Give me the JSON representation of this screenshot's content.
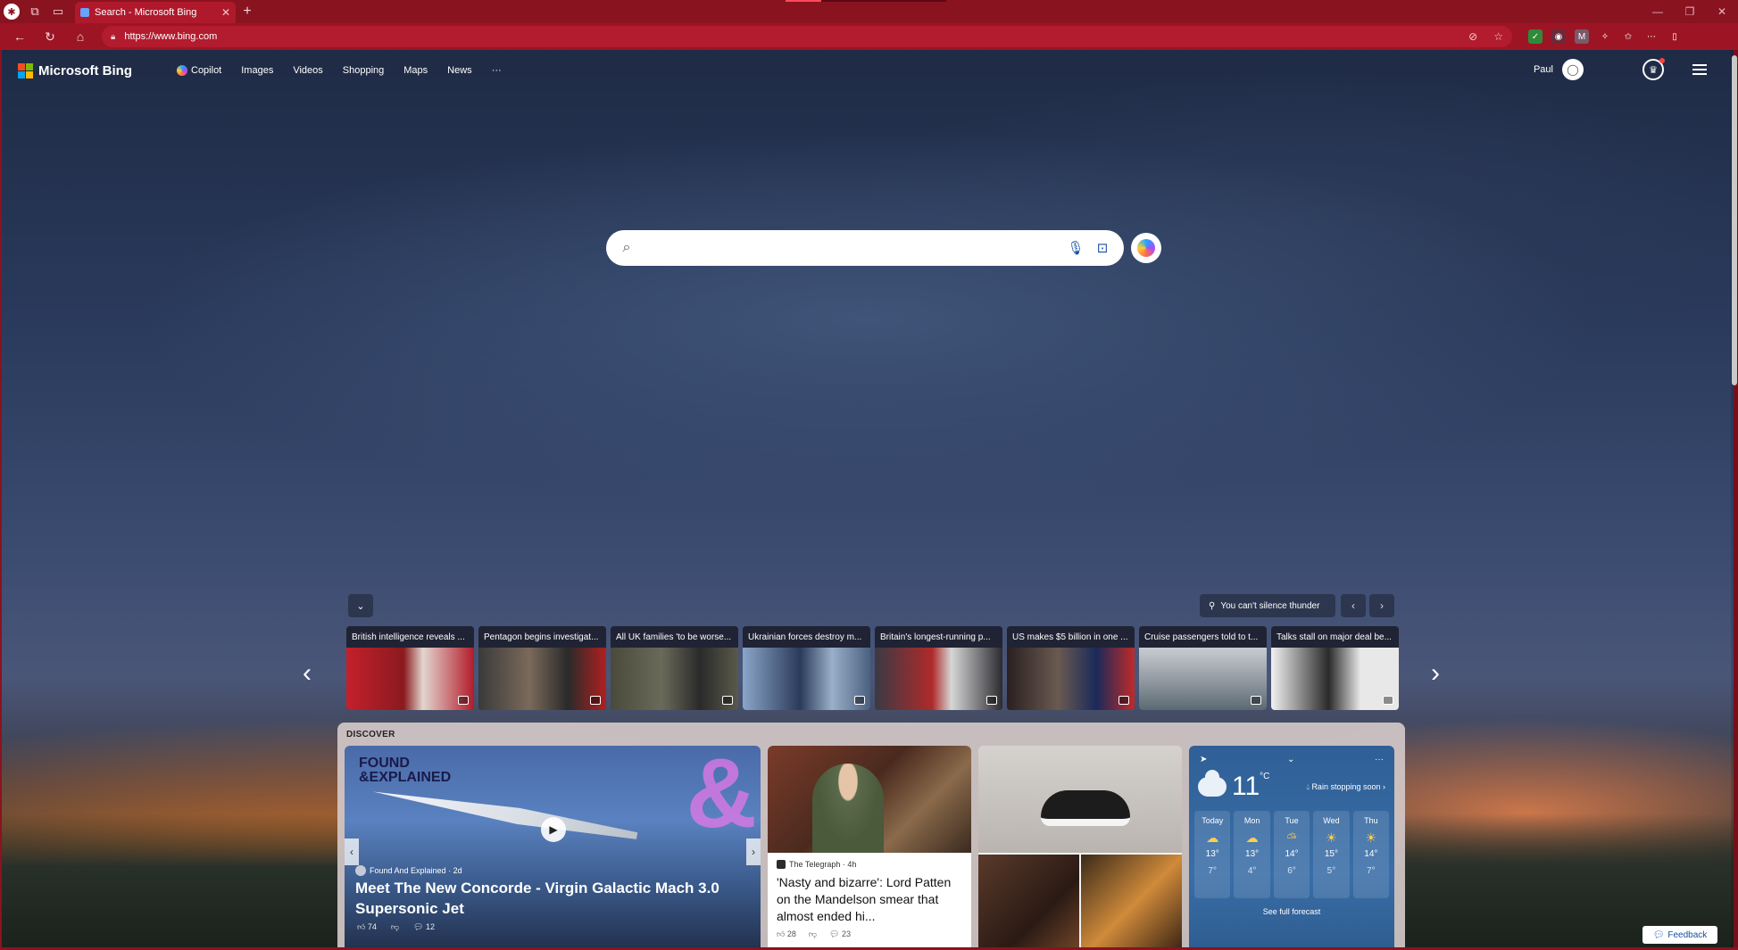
{
  "browser": {
    "tab_title": "Search - Microsoft Bing",
    "url": "https://www.bing.com"
  },
  "header": {
    "brand": "Microsoft Bing",
    "nav": [
      {
        "label": "Copilot"
      },
      {
        "label": "Images"
      },
      {
        "label": "Videos"
      },
      {
        "label": "Shopping"
      },
      {
        "label": "Maps"
      },
      {
        "label": "News"
      },
      {
        "label": "···"
      }
    ],
    "user": "Paul"
  },
  "search": {
    "placeholder": ""
  },
  "image_info": {
    "title": "You can't silence thunder"
  },
  "news": [
    {
      "headline": "British intelligence reveals ..."
    },
    {
      "headline": "Pentagon begins investigat..."
    },
    {
      "headline": "All UK families 'to be worse..."
    },
    {
      "headline": "Ukrainian forces destroy m..."
    },
    {
      "headline": "Britain's longest-running p..."
    },
    {
      "headline": "US makes $5 billion in one ..."
    },
    {
      "headline": "Cruise passengers told to t..."
    },
    {
      "headline": "Talks stall on major deal be..."
    }
  ],
  "discover": {
    "label": "DISCOVER",
    "hero": {
      "brand_line1": "FOUND",
      "brand_line2": "&EXPLAINED",
      "source": "Found And Explained · 2d",
      "headline": "Meet The New Concorde - Virgin Galactic Mach 3.0 Supersonic Jet",
      "likes": "74",
      "comments": "12"
    },
    "article": {
      "source": "The Telegraph · 4h",
      "title": "'Nasty and bizarre': Lord Patten on the Mandelson smear that almost ended hi...",
      "likes": "28",
      "comments": "23"
    },
    "weather": {
      "temp": "11",
      "unit": "°C",
      "condition": "Rain stopping soon",
      "days": [
        {
          "day": "Today",
          "hi": "13°",
          "lo": "7°"
        },
        {
          "day": "Mon",
          "hi": "13°",
          "lo": "4°"
        },
        {
          "day": "Tue",
          "hi": "14°",
          "lo": "6°"
        },
        {
          "day": "Wed",
          "hi": "15°",
          "lo": "5°"
        },
        {
          "day": "Thu",
          "hi": "14°",
          "lo": "7°"
        }
      ],
      "full_forecast": "See full forecast"
    }
  },
  "feedback": "Feedback"
}
